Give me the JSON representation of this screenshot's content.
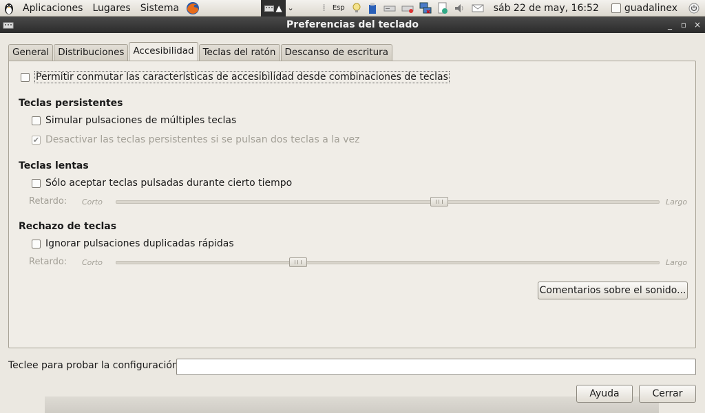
{
  "panel": {
    "menus": [
      "Aplicaciones",
      "Lugares",
      "Sistema"
    ],
    "keyboard_layout": "Esp",
    "clock": "sáb 22 de may, 16:52",
    "username": "guadalinex"
  },
  "window": {
    "title": "Preferencias del teclado"
  },
  "tabs": [
    {
      "label": "General"
    },
    {
      "label": "Distribuciones"
    },
    {
      "label": "Accesibilidad",
      "active": true
    },
    {
      "label": "Teclas del ratón"
    },
    {
      "label": "Descanso de escritura"
    }
  ],
  "accessibility": {
    "toggle_label": "Permitir conmutar las características de accesibilidad desde combinaciones de teclas",
    "sticky": {
      "heading": "Teclas persistentes",
      "simulate_label": "Simular pulsaciones de múltiples teclas",
      "disable_label": "Desactivar las teclas persistentes si se pulsan dos teclas a la vez"
    },
    "slow": {
      "heading": "Teclas lentas",
      "accept_label": "Sólo aceptar teclas pulsadas durante cierto tiempo",
      "delay_label": "Retardo:",
      "low_label": "Corto",
      "high_label": "Largo",
      "value": 0.595
    },
    "bounce": {
      "heading": "Rechazo de teclas",
      "ignore_label": "Ignorar pulsaciones duplicadas rápidas",
      "delay_label": "Retardo:",
      "low_label": "Corto",
      "high_label": "Largo",
      "value": 0.335
    },
    "sound_button": "Comentarios sobre el sonido..."
  },
  "test": {
    "label": "Teclee para probar la configuración:",
    "value": ""
  },
  "buttons": {
    "help": "Ayuda",
    "close": "Cerrar"
  },
  "colors": {
    "dialog_bg": "#ebe8e1",
    "titlebar": "#2b2b2b"
  }
}
